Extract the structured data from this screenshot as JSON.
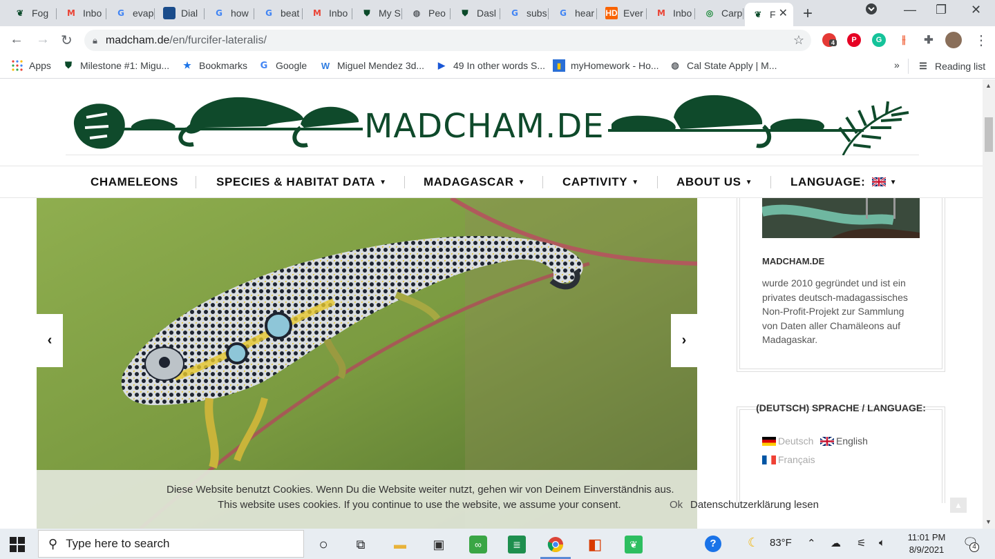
{
  "browser": {
    "tabs": [
      {
        "label": "Fog",
        "icon": "leaf-icon"
      },
      {
        "label": "Inbo",
        "icon": "gmail-icon"
      },
      {
        "label": "evap",
        "icon": "google-icon"
      },
      {
        "label": "Dial",
        "icon": "wave-icon"
      },
      {
        "label": "how",
        "icon": "google-icon"
      },
      {
        "label": "beat",
        "icon": "google-icon"
      },
      {
        "label": "Inbo",
        "icon": "gmail-icon"
      },
      {
        "label": "My S",
        "icon": "badge-icon"
      },
      {
        "label": "Peo",
        "icon": "globe-icon"
      },
      {
        "label": "Dasl",
        "icon": "badge-icon"
      },
      {
        "label": "subs",
        "icon": "google-icon"
      },
      {
        "label": "hear",
        "icon": "google-icon"
      },
      {
        "label": "Ever",
        "icon": "homedepot-icon"
      },
      {
        "label": "Inbo",
        "icon": "gmail-icon"
      },
      {
        "label": "Carp",
        "icon": "chameleon-icon"
      },
      {
        "label": "F",
        "icon": "leaf-icon"
      }
    ],
    "url_host": "madcham.de",
    "url_path": "/en/furcifer-lateralis/",
    "extension_badge": "4",
    "bookmarks": [
      {
        "label": "Apps"
      },
      {
        "label": "Milestone #1: Migu..."
      },
      {
        "label": "Bookmarks"
      },
      {
        "label": "Google"
      },
      {
        "label": "Miguel Mendez 3d..."
      },
      {
        "label": "49 In other words S..."
      },
      {
        "label": "myHomework - Ho..."
      },
      {
        "label": "Cal State Apply | M..."
      }
    ],
    "bookmarks_overflow": "»",
    "reading_list": "Reading list"
  },
  "site": {
    "logo_text": "MADCHAM.DE",
    "nav": [
      {
        "label": "CHAMELEONS",
        "has_dropdown": false
      },
      {
        "label": "SPECIES & HABITAT DATA",
        "has_dropdown": true
      },
      {
        "label": "MADAGASCAR",
        "has_dropdown": true
      },
      {
        "label": "CAPTIVITY",
        "has_dropdown": true
      },
      {
        "label": "ABOUT US",
        "has_dropdown": true
      },
      {
        "label": "LANGUAGE:",
        "has_dropdown": true
      }
    ],
    "slider": {
      "prev": "‹",
      "next": "›"
    },
    "sidebar": {
      "about_title": "MADCHAM.DE",
      "about_text": "wurde 2010 gegründet und ist ein privates deutsch-madagassisches Non-Profit-Projekt zur Sammlung von Daten aller Chamäleons auf Madagaskar.",
      "language_title": "(DEUTSCH) SPRACHE / LANGUAGE:",
      "languages": [
        {
          "label": "Deutsch",
          "active": false
        },
        {
          "label": "English",
          "active": true
        },
        {
          "label": "Français",
          "active": false
        }
      ]
    },
    "cookie": {
      "line_de": "Diese Website benutzt Cookies. Wenn Du die Website weiter nutzt, gehen wir von Deinem Einverständnis aus.",
      "line_en": "This website uses cookies. If you continue to use the website, we assume your consent.",
      "ok": "Ok",
      "privacy": "Datenschutzerklärung lesen"
    }
  },
  "taskbar": {
    "search_placeholder": "Type here to search",
    "weather": "83°F",
    "time": "11:01 PM",
    "date": "8/9/2021",
    "notification_count": "4"
  },
  "colors": {
    "brand_green": "#0f4a2b",
    "tabstrip": "#dee1e6"
  }
}
